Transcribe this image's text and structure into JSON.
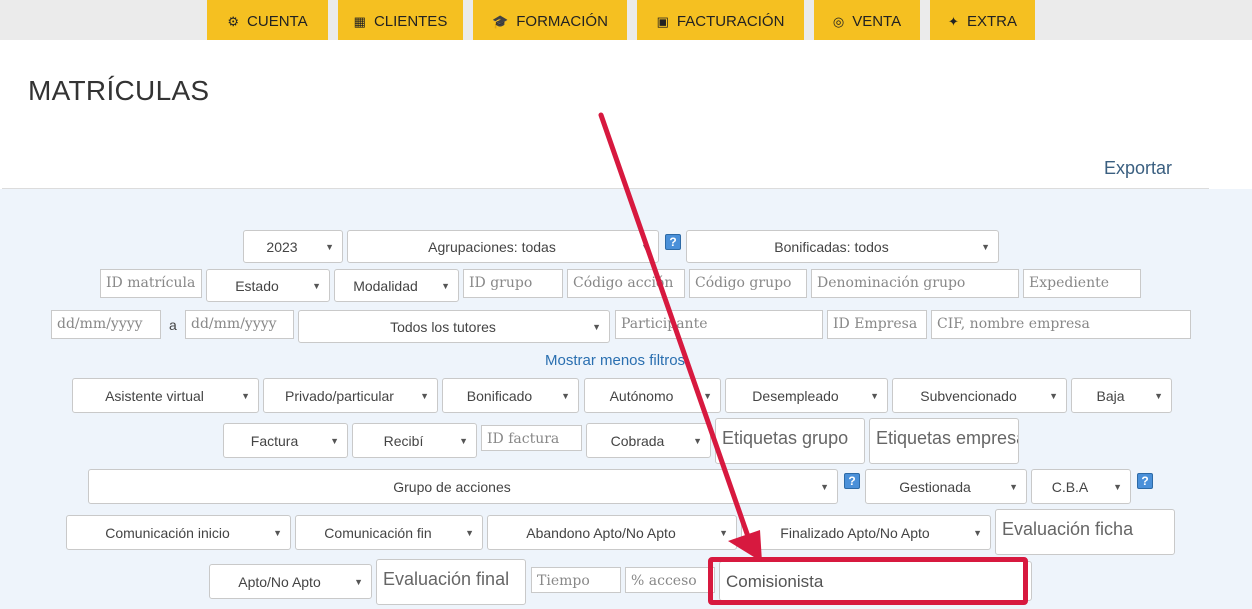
{
  "nav": {
    "items": [
      {
        "label": "CUENTA",
        "icon": "⚙"
      },
      {
        "label": "CLIENTES",
        "icon": "▦"
      },
      {
        "label": "FORMACIÓN",
        "icon": "🎓"
      },
      {
        "label": "FACTURACIÓN",
        "icon": "▣"
      },
      {
        "label": "VENTA",
        "icon": "◎"
      },
      {
        "label": "EXTRA",
        "icon": "✦"
      }
    ]
  },
  "page": {
    "title": "MATRÍCULAS",
    "export_label": "Exportar"
  },
  "filters": {
    "year": "2023",
    "agrupaciones": "Agrupaciones: todas",
    "bonificadas": "Bonificadas: todos",
    "id_matricula": "ID matrícula",
    "estado": "Estado",
    "modalidad": "Modalidad",
    "id_grupo": "ID grupo",
    "codigo_accion": "Código acción",
    "codigo_grupo": "Código grupo",
    "denominacion_grupo": "Denominación grupo",
    "expediente": "Expediente",
    "fecha_desde": "dd/mm/yyyy",
    "separador": "a",
    "fecha_hasta": "dd/mm/yyyy",
    "tutores": "Todos los tutores",
    "participante": "Participante",
    "id_empresa": "ID Empresa",
    "cif_empresa": "CIF, nombre empresa",
    "toggle_link": "Mostrar menos filtros",
    "asistente_virtual": "Asistente virtual",
    "privado": "Privado/particular",
    "bonificado": "Bonificado",
    "autonomo": "Autónomo",
    "desempleado": "Desempleado",
    "subvencionado": "Subvencionado",
    "baja": "Baja",
    "factura": "Factura",
    "recibi": "Recibí",
    "id_factura": "ID factura",
    "cobrada": "Cobrada",
    "etiquetas_grupo": "Etiquetas grupo",
    "etiquetas_empresa": "Etiquetas empresa",
    "grupo_acciones": "Grupo de acciones",
    "gestionada": "Gestionada",
    "cba": "C.B.A",
    "comunicacion_inicio": "Comunicación inicio",
    "comunicacion_fin": "Comunicación fin",
    "abandono": "Abandono Apto/No Apto",
    "finalizado": "Finalizado Apto/No Apto",
    "evaluacion_ficha": "Evaluación ficha",
    "apto": "Apto/No Apto",
    "evaluacion_final": "Evaluación final",
    "tiempo": "Tiempo",
    "acceso": "% acceso",
    "comisionista": "Comisionista",
    "help": "?"
  }
}
